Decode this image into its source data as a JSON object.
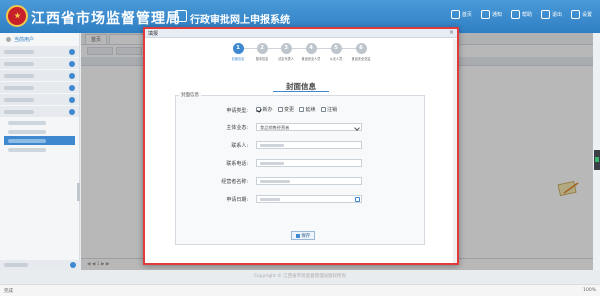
{
  "header": {
    "org_title": "江西省市场监督管理局",
    "system_title": "行政审批网上申报系统",
    "links": [
      {
        "icon": "home-icon",
        "label": "首页"
      },
      {
        "icon": "bell-icon",
        "label": "通知"
      },
      {
        "icon": "user-icon",
        "label": "帮助"
      },
      {
        "icon": "logout-icon",
        "label": "退出"
      },
      {
        "icon": "gear-icon",
        "label": "设置"
      }
    ]
  },
  "sidebar": {
    "user_label": "当前用户"
  },
  "main": {
    "tab_label": "首页"
  },
  "dialog": {
    "title": "填报",
    "close": "×",
    "steps": [
      {
        "num": "1",
        "label": "封面信息",
        "active": true
      },
      {
        "num": "2",
        "label": "基本信息",
        "active": false
      },
      {
        "num": "3",
        "label": "法定代表人",
        "active": false
      },
      {
        "num": "4",
        "label": "食品安全人员",
        "active": false
      },
      {
        "num": "5",
        "label": "从业人员",
        "active": false
      },
      {
        "num": "6",
        "label": "食品安全总监",
        "active": false
      }
    ],
    "section_title": "封面信息",
    "fieldset_legend": "封面信息",
    "form": {
      "apply_type_label": "申请类型:",
      "apply_types": [
        {
          "label": "新办",
          "checked": true
        },
        {
          "label": "变更",
          "checked": false
        },
        {
          "label": "延续",
          "checked": false
        },
        {
          "label": "注销",
          "checked": false
        }
      ],
      "entity_label": "主体业态:",
      "entity_value": "食品销售经营者",
      "contact_label": "联系人:",
      "phone_label": "联系电话:",
      "operator_label": "经营者名称:",
      "date_label": "申请日期:",
      "save_label": "保存"
    }
  },
  "footer": {
    "copyright": "Copyright © 江西省市场监督管理局版权所有"
  },
  "statusbar": {
    "left": "完成",
    "right": "100%"
  }
}
